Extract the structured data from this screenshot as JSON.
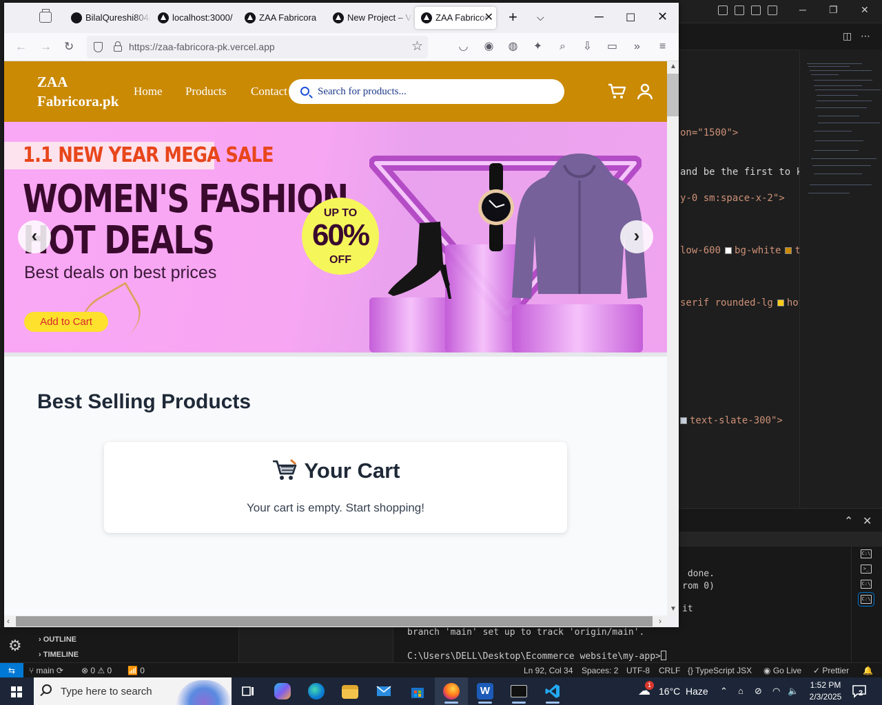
{
  "browser": {
    "tabs": [
      {
        "label": "BilalQureshi804/"
      },
      {
        "label": "localhost:3000/"
      },
      {
        "label": "ZAA Fabricora"
      },
      {
        "label": "New Project – V"
      },
      {
        "label": "ZAA Fabricor"
      }
    ],
    "url": "https://zaa-fabricora-pk.vercel.app"
  },
  "site": {
    "brand_line1": "ZAA",
    "brand_line2": "Fabricora.pk",
    "nav": [
      "Home",
      "Products",
      "Contact"
    ],
    "search_placeholder": "Search for products...",
    "banner": {
      "sale": "1.1 NEW YEAR MEGA SALE",
      "headline1": "WOMEN'S FASHION",
      "headline2": "HOT DEALS",
      "subtitle": "Best deals on best prices",
      "button": "Add to Cart",
      "badge_top": "UP TO",
      "badge_mid": "60%",
      "badge_bot": "OFF",
      "prev": "‹",
      "next": "›"
    },
    "section_title": "Best Selling Products",
    "cart": {
      "title": "Your Cart",
      "empty": "Your cart is empty. Start shopping!"
    }
  },
  "vscode": {
    "code": [
      {
        "text": "on=\"1500\">"
      },
      {
        "text": " and be the first to kn"
      },
      {
        "text": "y-0 sm:space-x-2\">"
      },
      {
        "text": "low-600",
        "a": "bg-white",
        "b": "te"
      },
      {
        "text": "serif rounded-lg",
        "a": "hove"
      },
      {
        "text": "text-slate-300\">"
      }
    ],
    "terminal": [
      " done.",
      "rom 0)",
      "it",
      "branch 'main' set up to track 'origin/main'.",
      "C:\\Users\\DELL\\Desktop\\Ecommerce website\\my-app>"
    ],
    "outline": "OUTLINE",
    "timeline": "TIMELINE",
    "status": {
      "branch": "main",
      "errors": "0",
      "warnings": "0",
      "ports": "0",
      "position": "Ln 92, Col 34",
      "spaces": "Spaces: 2",
      "encoding": "UTF-8",
      "eol": "CRLF",
      "language": "TypeScript JSX",
      "golive": "Go Live",
      "prettier": "Prettier"
    }
  },
  "taskbar": {
    "search_placeholder": "Type here to search",
    "temp": "16°C",
    "weather": "Haze",
    "weather_badge": "1",
    "time": "1:52 PM",
    "date": "2/3/2025",
    "notif_count": "2"
  },
  "colors": {
    "header": "#ca8a04",
    "accent_blue": "#1d4ed8",
    "taskbar": "#1c2638"
  }
}
